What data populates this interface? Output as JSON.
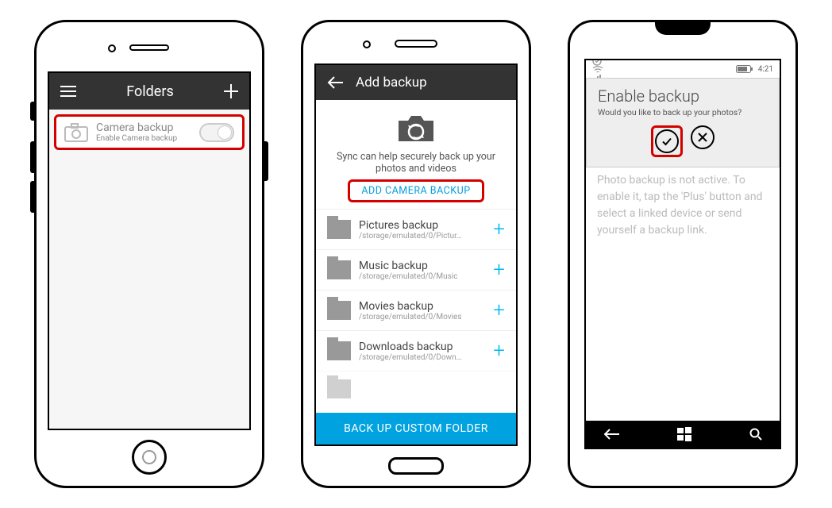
{
  "ios": {
    "header": {
      "title": "Folders"
    },
    "row": {
      "title": "Camera backup",
      "subtitle": "Enable Camera backup"
    }
  },
  "android": {
    "header": {
      "title": "Add backup"
    },
    "hero": {
      "text": "Sync can help securely back up your photos and videos",
      "cta": "ADD CAMERA BACKUP"
    },
    "items": [
      {
        "title": "Pictures backup",
        "path": "/storage/emulated/0/Pictur…"
      },
      {
        "title": "Music backup",
        "path": "/storage/emulated/0/Music"
      },
      {
        "title": "Movies backup",
        "path": "/storage/emulated/0/Movies"
      },
      {
        "title": "Downloads backup",
        "path": "/storage/emulated/0/Down…"
      }
    ],
    "footer": "BACK UP CUSTOM FOLDER"
  },
  "win": {
    "status": {
      "time": "4:21"
    },
    "dialog": {
      "title": "Enable backup",
      "subtitle": "Would you like to back up your photos?"
    },
    "body": "Photo backup is not active. To enable it, tap the 'Plus' button and select a linked device or send yourself a backup link."
  }
}
